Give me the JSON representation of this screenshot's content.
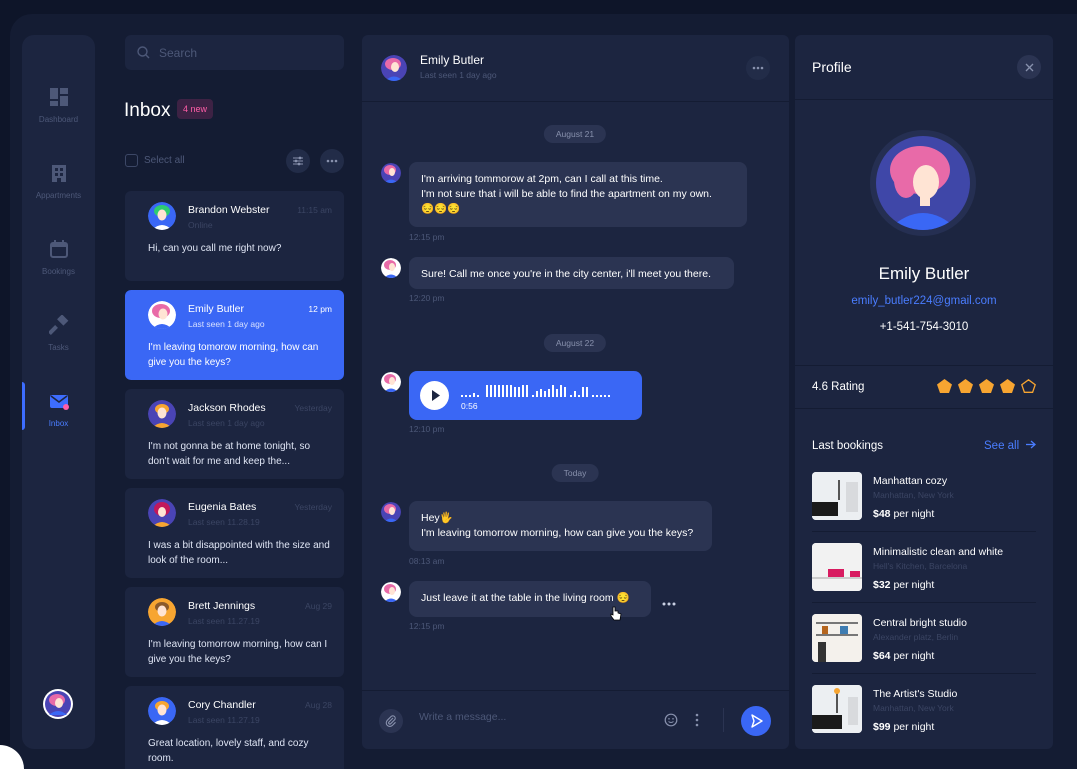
{
  "sidebar": {
    "items": [
      {
        "label": "Dashboard",
        "icon": "dashboard-icon"
      },
      {
        "label": "Appartments",
        "icon": "building-icon"
      },
      {
        "label": "Bookings",
        "icon": "calendar-icon"
      },
      {
        "label": "Tasks",
        "icon": "hammer-icon"
      },
      {
        "label": "Inbox",
        "icon": "mail-icon"
      }
    ]
  },
  "search": {
    "placeholder": "Search"
  },
  "inbox": {
    "title": "Inbox",
    "badge": "4 new",
    "select_all": "Select all",
    "messages": [
      {
        "name": "Brandon Webster",
        "status": "Online",
        "time": "11:15 am",
        "preview": "Hi, can you call me right now?",
        "unread": true
      },
      {
        "name": "Emily Butler",
        "status": "Last seen 1 day ago",
        "time": "12 pm",
        "preview": "I'm leaving tomorow morning, how can give you the keys?",
        "unread": false
      },
      {
        "name": "Jackson Rhodes",
        "status": "Last seen 1 day ago",
        "time": "Yesterday",
        "preview": "I'm not gonna be at home tonight, so don't wait for me and keep the...",
        "unread": true
      },
      {
        "name": "Eugenia Bates",
        "status": "Last seen 11.28.19",
        "time": "Yesterday",
        "preview": "I was a bit disappointed with the size and look of the room...",
        "unread": true
      },
      {
        "name": "Brett Jennings",
        "status": "Last seen 11.27.19",
        "time": "Aug 29",
        "preview": "I'm leaving tomorrow morning, how can I give you the keys?",
        "unread": true
      },
      {
        "name": "Cory Chandler",
        "status": "Last seen 11.27.19",
        "time": "Aug 28",
        "preview": "Great location, lovely staff, and cozy room.",
        "unread": false
      }
    ]
  },
  "chat": {
    "name": "Emily Butler",
    "status": "Last seen 1 day ago",
    "dates": [
      "August 21",
      "August 22",
      "Today"
    ],
    "messages": [
      {
        "line1": "I'm arriving tommorow at 2pm, can I call at this time.",
        "line2": "I'm not sure that i will be able to find the apartment on my own.",
        "line3": "😔😔😔",
        "time": "12:15 pm"
      },
      {
        "line1": "Sure! Call me once you're in the city center, i'll meet you there.",
        "time": "12:20 pm"
      },
      {
        "voice_duration": "0:56",
        "time": "12:10 pm"
      },
      {
        "line1": "Hey🖐",
        "line2": "I'm leaving tomorrow morning, how can give you the keys?",
        "time": "08:13 am"
      },
      {
        "line1": "Just leave it at the table in the living room 😔",
        "time": "12:15 pm"
      }
    ],
    "input_placeholder": "Write a message..."
  },
  "profile": {
    "title": "Profile",
    "name": "Emily Butler",
    "email": "emily_butler224@gmail.com",
    "phone": "+1-541-754-3010",
    "rating_label": "4.6 Rating",
    "rating_value": 4.6,
    "last_bookings": "Last bookings",
    "see_all": "See all",
    "bookings": [
      {
        "name": "Manhattan cozy",
        "location": "Manhattan, New York",
        "price": "$48",
        "per": " per night"
      },
      {
        "name": "Minimalistic clean and white",
        "location": "Hell's Kitchen, Barcelona",
        "price": "$32",
        "per": " per night"
      },
      {
        "name": "Central bright studio",
        "location": "Alexander platz, Berlin",
        "price": "$64",
        "per": " per night"
      },
      {
        "name": "The Artist's Studio",
        "location": "Manhattan, New York",
        "price": "$99",
        "per": " per night"
      }
    ]
  },
  "colors": {
    "accent": "#3a67f5",
    "unread": "#ff5ea8",
    "star": "#f7a531",
    "panel": "#1c2540",
    "bg": "#0e1529"
  }
}
